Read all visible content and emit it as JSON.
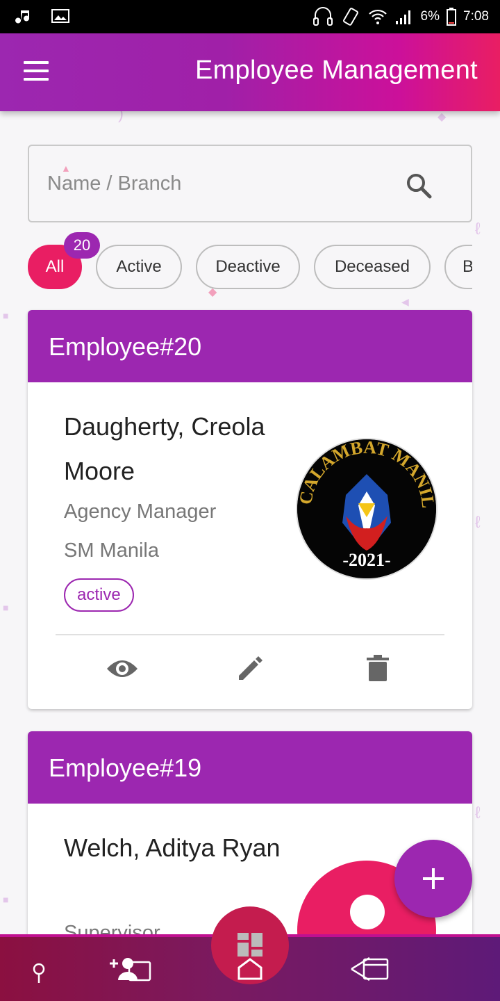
{
  "status_bar": {
    "battery": "6%",
    "time": "7:08"
  },
  "app_bar": {
    "title": "Employee Management"
  },
  "search": {
    "placeholder": "Name / Branch",
    "value": ""
  },
  "filters": {
    "all_count": "20",
    "chips": [
      {
        "label": "All",
        "selected": true
      },
      {
        "label": "Active",
        "selected": false
      },
      {
        "label": "Deactive",
        "selected": false
      },
      {
        "label": "Deceased",
        "selected": false
      },
      {
        "label": "B",
        "selected": false
      }
    ]
  },
  "employees": [
    {
      "header": "Employee#20",
      "name": "Daugherty, Creola Moore",
      "position": "Agency Manager",
      "branch": "SM Manila",
      "status": "active",
      "avatar_text": "CALAMBAT MANILA",
      "avatar_year": "-2021-"
    },
    {
      "header": "Employee#19",
      "name": "Welch, Aditya Ryan",
      "position": "Supervisor"
    }
  ],
  "colors": {
    "primary": "#9c27b0",
    "accent": "#e91e63"
  },
  "icons": [
    "menu-icon",
    "search-icon",
    "eye-icon",
    "edit-icon",
    "delete-icon",
    "plus-icon",
    "location-icon",
    "add-user-icon",
    "dashboard-icon",
    "home-icon",
    "back-icon"
  ]
}
